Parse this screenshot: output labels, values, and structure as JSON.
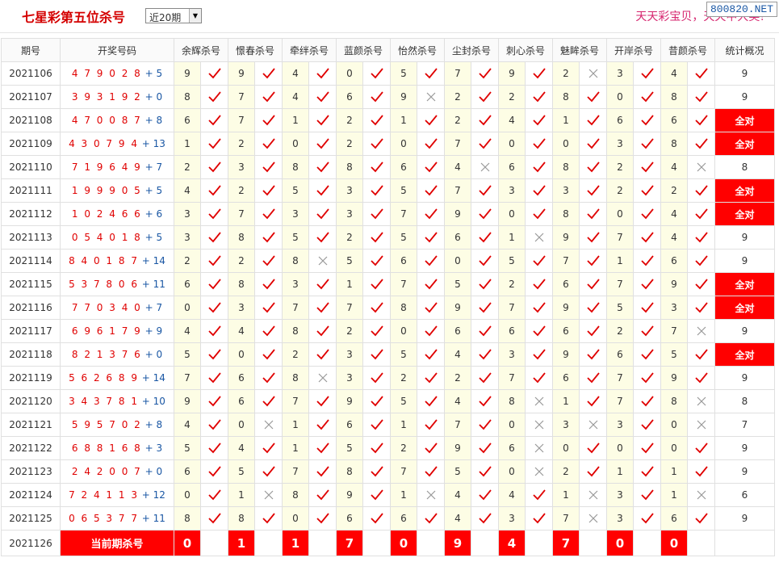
{
  "header": {
    "title": "七星彩第五位杀号",
    "period_select": "近20期",
    "promo": "天天彩宝贝，天天中大奖!",
    "watermark": "800820.NET"
  },
  "columns": {
    "period": "期号",
    "draw": "开奖号码",
    "experts": [
      "余辉杀号",
      "憬春杀号",
      "牵绊杀号",
      "蓝颜杀号",
      "怡然杀号",
      "尘封杀号",
      "刺心杀号",
      "魅眸杀号",
      "开岸杀号",
      "昔颜杀号"
    ],
    "stats": "统计概况"
  },
  "rows": [
    {
      "period": "2021106",
      "digits": "479028",
      "extra": "5",
      "kills": [
        "9",
        "9",
        "4",
        "0",
        "5",
        "7",
        "9",
        "2",
        "3",
        "4"
      ],
      "hits": [
        1,
        1,
        1,
        1,
        1,
        1,
        1,
        0,
        1,
        1
      ],
      "stat": "9"
    },
    {
      "period": "2021107",
      "digits": "393192",
      "extra": "0",
      "kills": [
        "8",
        "7",
        "4",
        "6",
        "9",
        "2",
        "2",
        "8",
        "0",
        "8"
      ],
      "hits": [
        1,
        1,
        1,
        1,
        0,
        1,
        1,
        1,
        1,
        1
      ],
      "stat": "9"
    },
    {
      "period": "2021108",
      "digits": "470087",
      "extra": "8",
      "kills": [
        "6",
        "7",
        "1",
        "2",
        "1",
        "2",
        "4",
        "1",
        "6",
        "6"
      ],
      "hits": [
        1,
        1,
        1,
        1,
        1,
        1,
        1,
        1,
        1,
        1
      ],
      "stat": "全对"
    },
    {
      "period": "2021109",
      "digits": "430794",
      "extra": "13",
      "kills": [
        "1",
        "2",
        "0",
        "2",
        "0",
        "7",
        "0",
        "0",
        "3",
        "8"
      ],
      "hits": [
        1,
        1,
        1,
        1,
        1,
        1,
        1,
        1,
        1,
        1
      ],
      "stat": "全对"
    },
    {
      "period": "2021110",
      "digits": "719649",
      "extra": "7",
      "kills": [
        "2",
        "3",
        "8",
        "8",
        "6",
        "4",
        "6",
        "8",
        "2",
        "4"
      ],
      "hits": [
        1,
        1,
        1,
        1,
        1,
        0,
        1,
        1,
        1,
        0
      ],
      "stat": "8"
    },
    {
      "period": "2021111",
      "digits": "199905",
      "extra": "5",
      "kills": [
        "4",
        "2",
        "5",
        "3",
        "5",
        "7",
        "3",
        "3",
        "2",
        "2"
      ],
      "hits": [
        1,
        1,
        1,
        1,
        1,
        1,
        1,
        1,
        1,
        1
      ],
      "stat": "全对"
    },
    {
      "period": "2021112",
      "digits": "102466",
      "extra": "6",
      "kills": [
        "3",
        "7",
        "3",
        "3",
        "7",
        "9",
        "0",
        "8",
        "0",
        "4"
      ],
      "hits": [
        1,
        1,
        1,
        1,
        1,
        1,
        1,
        1,
        1,
        1
      ],
      "stat": "全对"
    },
    {
      "period": "2021113",
      "digits": "054018",
      "extra": "5",
      "kills": [
        "3",
        "8",
        "5",
        "2",
        "5",
        "6",
        "1",
        "9",
        "7",
        "4"
      ],
      "hits": [
        1,
        1,
        1,
        1,
        1,
        1,
        0,
        1,
        1,
        1
      ],
      "stat": "9"
    },
    {
      "period": "2021114",
      "digits": "840187",
      "extra": "14",
      "kills": [
        "2",
        "2",
        "8",
        "5",
        "6",
        "0",
        "5",
        "7",
        "1",
        "6"
      ],
      "hits": [
        1,
        1,
        0,
        1,
        1,
        1,
        1,
        1,
        1,
        1
      ],
      "stat": "9"
    },
    {
      "period": "2021115",
      "digits": "537806",
      "extra": "11",
      "kills": [
        "6",
        "8",
        "3",
        "1",
        "7",
        "5",
        "2",
        "6",
        "7",
        "9"
      ],
      "hits": [
        1,
        1,
        1,
        1,
        1,
        1,
        1,
        1,
        1,
        1
      ],
      "stat": "全对"
    },
    {
      "period": "2021116",
      "digits": "770340",
      "extra": "7",
      "kills": [
        "0",
        "3",
        "7",
        "7",
        "8",
        "9",
        "7",
        "9",
        "5",
        "3"
      ],
      "hits": [
        1,
        1,
        1,
        1,
        1,
        1,
        1,
        1,
        1,
        1
      ],
      "stat": "全对"
    },
    {
      "period": "2021117",
      "digits": "696179",
      "extra": "9",
      "kills": [
        "4",
        "4",
        "8",
        "2",
        "0",
        "6",
        "6",
        "6",
        "2",
        "7"
      ],
      "hits": [
        1,
        1,
        1,
        1,
        1,
        1,
        1,
        1,
        1,
        0
      ],
      "stat": "9"
    },
    {
      "period": "2021118",
      "digits": "821376",
      "extra": "0",
      "kills": [
        "5",
        "0",
        "2",
        "3",
        "5",
        "4",
        "3",
        "9",
        "6",
        "5"
      ],
      "hits": [
        1,
        1,
        1,
        1,
        1,
        1,
        1,
        1,
        1,
        1
      ],
      "stat": "全对"
    },
    {
      "period": "2021119",
      "digits": "562689",
      "extra": "14",
      "kills": [
        "7",
        "6",
        "8",
        "3",
        "2",
        "2",
        "7",
        "6",
        "7",
        "9"
      ],
      "hits": [
        1,
        1,
        0,
        1,
        1,
        1,
        1,
        1,
        1,
        1
      ],
      "stat": "9"
    },
    {
      "period": "2021120",
      "digits": "343781",
      "extra": "10",
      "kills": [
        "9",
        "6",
        "7",
        "9",
        "5",
        "4",
        "8",
        "1",
        "7",
        "8"
      ],
      "hits": [
        1,
        1,
        1,
        1,
        1,
        1,
        0,
        1,
        1,
        0
      ],
      "stat": "8"
    },
    {
      "period": "2021121",
      "digits": "595702",
      "extra": "8",
      "kills": [
        "4",
        "0",
        "1",
        "6",
        "1",
        "7",
        "0",
        "3",
        "3",
        "0"
      ],
      "hits": [
        1,
        0,
        1,
        1,
        1,
        1,
        0,
        0,
        1,
        0
      ],
      "stat": "7"
    },
    {
      "period": "2021122",
      "digits": "688168",
      "extra": "3",
      "kills": [
        "5",
        "4",
        "1",
        "5",
        "2",
        "9",
        "6",
        "0",
        "0",
        "0"
      ],
      "hits": [
        1,
        1,
        1,
        1,
        1,
        1,
        0,
        1,
        1,
        1
      ],
      "stat": "9"
    },
    {
      "period": "2021123",
      "digits": "242007",
      "extra": "0",
      "kills": [
        "6",
        "5",
        "7",
        "8",
        "7",
        "5",
        "0",
        "2",
        "1",
        "1"
      ],
      "hits": [
        1,
        1,
        1,
        1,
        1,
        1,
        0,
        1,
        1,
        1
      ],
      "stat": "9"
    },
    {
      "period": "2021124",
      "digits": "724113",
      "extra": "12",
      "kills": [
        "0",
        "1",
        "8",
        "9",
        "1",
        "4",
        "4",
        "1",
        "3",
        "1"
      ],
      "hits": [
        1,
        0,
        1,
        1,
        0,
        1,
        1,
        0,
        1,
        0
      ],
      "stat": "6"
    },
    {
      "period": "2021125",
      "digits": "065377",
      "extra": "11",
      "kills": [
        "8",
        "8",
        "0",
        "6",
        "6",
        "4",
        "3",
        "7",
        "3",
        "6"
      ],
      "hits": [
        1,
        1,
        1,
        1,
        1,
        1,
        1,
        0,
        1,
        1
      ],
      "stat": "9"
    }
  ],
  "current": {
    "period": "2021126",
    "label": "当前期杀号",
    "kills": [
      "0",
      "1",
      "1",
      "7",
      "0",
      "9",
      "4",
      "7",
      "0",
      "0"
    ]
  },
  "colors": {
    "hit": "#e00000",
    "miss": "#999999",
    "highlight": "#ff0000",
    "draw_digits": "#e00000",
    "draw_extra": "#1a57a4"
  }
}
